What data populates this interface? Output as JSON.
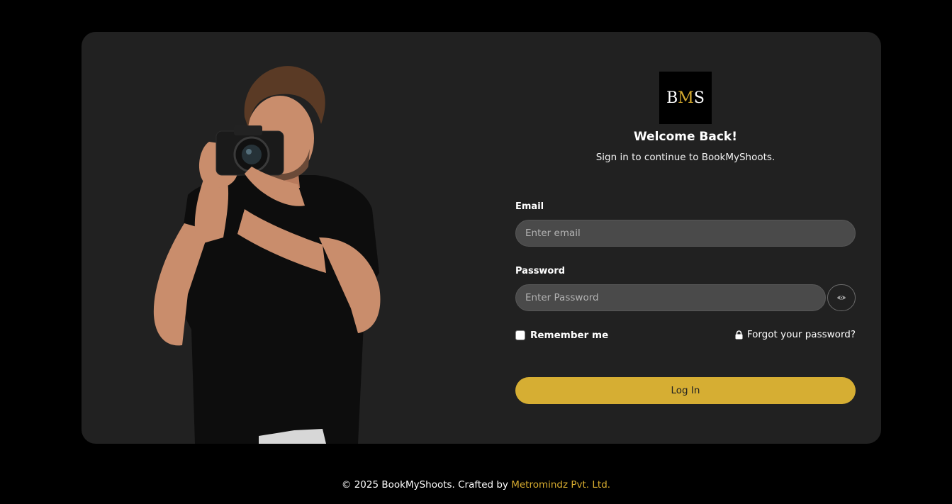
{
  "brand": {
    "logo_prefix": "B",
    "logo_y": "M",
    "logo_suffix": "S",
    "accent_color": "#d6ae33"
  },
  "form": {
    "welcome_title": "Welcome Back!",
    "subtitle": "Sign in to continue to BookMyShoots.",
    "email_label": "Email",
    "email_placeholder": "Enter email",
    "email_value": "",
    "password_label": "Password",
    "password_placeholder": "Enter Password",
    "password_value": "",
    "password_toggle_icon": "eye-icon",
    "remember_label": "Remember me",
    "remember_checked": false,
    "forgot_icon": "lock-icon",
    "forgot_label": "Forgot your password?",
    "login_label": "Log In"
  },
  "footer": {
    "copyright": "© 2025 BookMyShoots. Crafted by ",
    "company": "Metromindz Pvt. Ltd."
  }
}
